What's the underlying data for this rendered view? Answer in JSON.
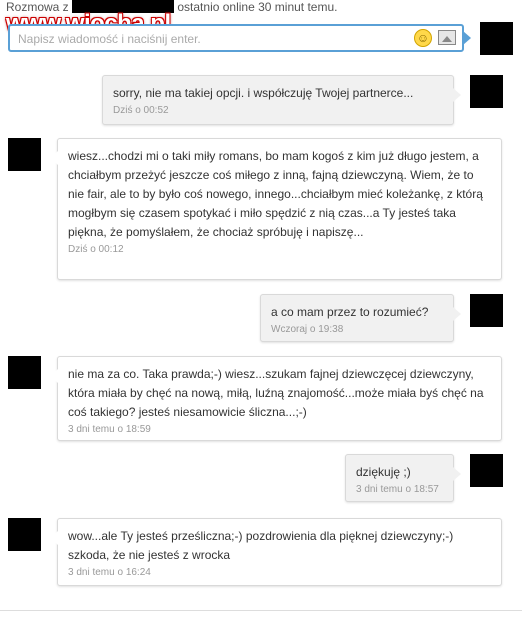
{
  "header": {
    "prefix": "Rozmowa z",
    "suffix": "ostatnio online 30 minut temu."
  },
  "watermark": "www.wiocha.pl",
  "composer": {
    "placeholder": "Napisz wiadomość i naciśnij enter.",
    "emoji_icon": "smiley-icon",
    "image_icon": "image-icon"
  },
  "messages": [
    {
      "side": "right",
      "text": "sorry, nie ma takiej opcji. i współczuję Twojej partnerce...",
      "time": "Dziś o 00:52"
    },
    {
      "side": "left",
      "text": "wiesz...chodzi mi o taki miły romans, bo mam kogoś z kim już długo jestem, a chciałbym przeżyć jeszcze coś miłego z inną, fajną dziewczyną. Wiem, że to nie fair, ale to by było coś nowego, innego...chciałbym mieć koleżankę, z którą mogłbym się czasem spotykać i miło spędzić z nią czas...a Ty jesteś taka piękna, że pomyślałem, że chociaż spróbuję i napiszę...",
      "time": "Dziś o 00:12"
    },
    {
      "side": "right",
      "text": "a co mam przez to rozumieć?",
      "time": "Wczoraj o 19:38"
    },
    {
      "side": "left",
      "text": "nie ma za co. Taka prawda;-) wiesz...szukam fajnej dziewczęcej dziewczyny, która miała by chęć na nową, miłą, luźną znajomość...może miała byś chęć na coś takiego? jesteś niesamowicie śliczna...;-)",
      "time": "3 dni temu o 18:59"
    },
    {
      "side": "right",
      "text": "dziękuję ;)",
      "time": "3 dni temu o 18:57"
    },
    {
      "side": "left",
      "text": "wow...ale Ty jesteś prześliczna;-) pozdrowienia dla pięknej dziewczyny;-) szkoda, że nie jesteś z wrocka",
      "time": "3 dni temu o 16:24"
    }
  ]
}
